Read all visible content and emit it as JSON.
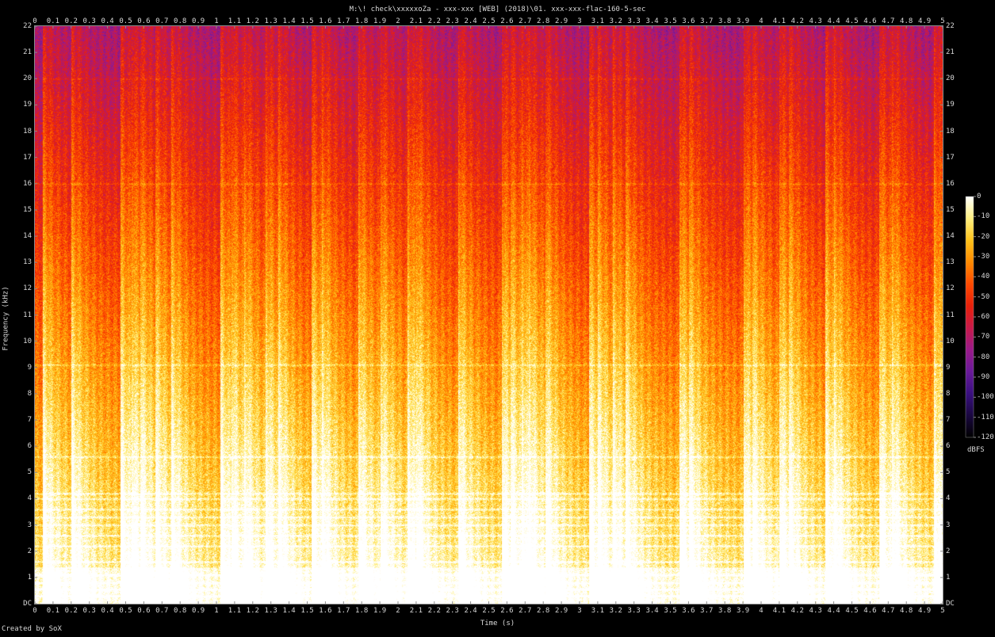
{
  "title": "M:\\! check\\xxxxxoZa - xxx-xxx [WEB] (2018)\\01. xxx-xxx-flac-160-5-sec",
  "credit": "Created by SoX",
  "chart_data": {
    "type": "heatmap",
    "title": "M:\\! check\\xxxxxoZa - xxx-xxx [WEB] (2018)\\01. xxx-xxx-flac-160-5-sec",
    "xlabel": "Time (s)",
    "ylabel": "Frequency (kHz)",
    "colorbar_label": "dBFS",
    "xlim": [
      0,
      5
    ],
    "ylim": [
      0,
      22
    ],
    "zlim": [
      -120,
      0
    ],
    "x_ticks": [
      "0",
      "0.1",
      "0.2",
      "0.3",
      "0.4",
      "0.5",
      "0.6",
      "0.7",
      "0.8",
      "0.9",
      "1",
      "1.1",
      "1.2",
      "1.3",
      "1.4",
      "1.5",
      "1.6",
      "1.7",
      "1.8",
      "1.9",
      "2",
      "2.1",
      "2.2",
      "2.3",
      "2.4",
      "2.5",
      "2.6",
      "2.7",
      "2.8",
      "2.9",
      "3",
      "3.1",
      "3.2",
      "3.3",
      "3.4",
      "3.5",
      "3.6",
      "3.7",
      "3.8",
      "3.9",
      "4",
      "4.1",
      "4.2",
      "4.3",
      "4.4",
      "4.5",
      "4.6",
      "4.7",
      "4.8",
      "4.9",
      "5"
    ],
    "y_ticks": [
      "DC",
      "1",
      "2",
      "3",
      "4",
      "5",
      "6",
      "7",
      "8",
      "9",
      "10",
      "11",
      "12",
      "13",
      "14",
      "15",
      "16",
      "17",
      "18",
      "19",
      "20",
      "21",
      "22"
    ],
    "colorbar_ticks": [
      "0",
      "-10",
      "-20",
      "-30",
      "-40",
      "-50",
      "-60",
      "-70",
      "-80",
      "-90",
      "-100",
      "-110",
      "-120"
    ],
    "colormap": [
      "#000000",
      "#1a0840",
      "#3a1080",
      "#6a1a9a",
      "#9a1a8a",
      "#c81a4a",
      "#e8200a",
      "#ff4a00",
      "#ff8a00",
      "#ffc21a",
      "#fff080",
      "#ffffff"
    ],
    "onsets_s": [
      0.04,
      0.2,
      0.47,
      0.53,
      0.58,
      0.66,
      0.75,
      1.02,
      1.08,
      1.15,
      1.27,
      1.34,
      1.52,
      1.58,
      1.78,
      1.9,
      2.05,
      2.1,
      2.33,
      2.57,
      2.62,
      2.68,
      2.72,
      2.81,
      3.05,
      3.1,
      3.18,
      3.25,
      3.55,
      3.6,
      3.9,
      3.95,
      4.1,
      4.15,
      4.35,
      4.4,
      4.65,
      4.72,
      4.95
    ],
    "tonal_lines_khz": [
      0.3,
      0.55,
      0.8,
      1.1,
      1.35,
      1.6,
      2.2,
      2.6,
      3.0,
      3.3,
      3.6,
      4.0,
      4.2,
      5.6,
      9.1,
      16.0,
      20.0
    ]
  }
}
